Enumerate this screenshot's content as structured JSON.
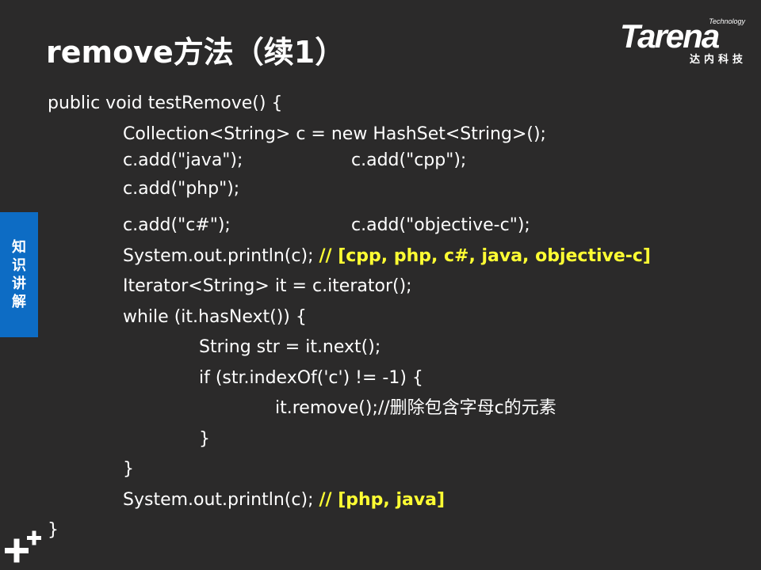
{
  "slide": {
    "title": "remove方法（续1）",
    "logo": {
      "small": "Technology",
      "main": "Tarena",
      "chinese": "达内科技"
    },
    "side_tab": [
      "知",
      "识",
      "讲",
      "解"
    ],
    "code": {
      "l1": "public void testRemove() {",
      "l2": "Collection<String> c = new HashSet<String>();",
      "l3a": "c.add(\"java\");",
      "l3b": "c.add(\"cpp\");",
      "l4": "c.add(\"php\");",
      "l5a": "c.add(\"c#\");",
      "l5b": "c.add(\"objective-c\");",
      "l6": "System.out.println(c);",
      "l6c": "// [cpp, php, c#, java, objective-c]",
      "l7": "Iterator<String> it = c.iterator();",
      "l8": "while (it.hasNext()) {",
      "l9": "String str = it.next();",
      "l10": "if (str.indexOf('c') != -1) {",
      "l11": "it.remove();//删除包含字母c的元素",
      "l12": "}",
      "l13": "}",
      "l14": "System.out.println(c);",
      "l14c": "// [php, java]",
      "l15": "}"
    },
    "colors": {
      "background": "#2b2a2a",
      "comment": "#ffff33",
      "side_tab": "#0d6cc4"
    }
  }
}
